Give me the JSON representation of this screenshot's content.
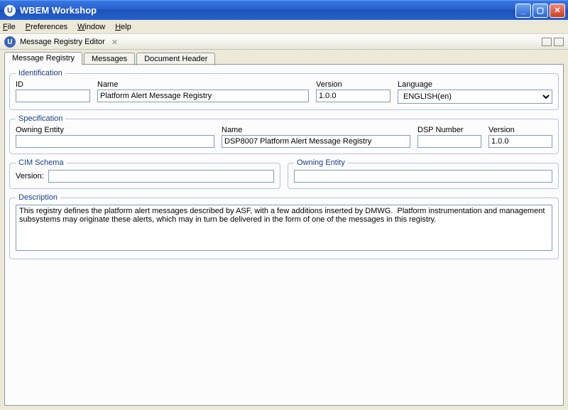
{
  "window": {
    "title": "WBEM Workshop"
  },
  "menubar": [
    "File",
    "Preferences",
    "Window",
    "Help"
  ],
  "editor": {
    "title": "Message Registry Editor"
  },
  "tabs": [
    "Message Registry",
    "Messages",
    "Document Header"
  ],
  "identification": {
    "legend": "Identification",
    "id_label": "ID",
    "id_value": "",
    "name_label": "Name",
    "name_value": "Platform Alert Message Registry",
    "version_label": "Version",
    "version_value": "1.0.0",
    "language_label": "Language",
    "language_value": "ENGLISH(en)"
  },
  "specification": {
    "legend": "Specification",
    "owning_label": "Owning Entity",
    "owning_value": "",
    "name_label": "Name",
    "name_value": "DSP8007 Platform Alert Message Registry",
    "dsp_label": "DSP Number",
    "dsp_value": "",
    "version_label": "Version",
    "version_value": "1.0.0"
  },
  "cimschema": {
    "legend": "CIM Schema",
    "version_label": "Version:",
    "version_value": ""
  },
  "owning_entity": {
    "legend": "Owning Entity",
    "value": ""
  },
  "description": {
    "legend": "Description",
    "text": "This registry defines the platform alert messages described by ASF, with a few additions inserted by DMWG.  Platform instrumentation and management subsystems may originate these alerts, which may in turn be delivered in the form of one of the messages in this registry."
  }
}
